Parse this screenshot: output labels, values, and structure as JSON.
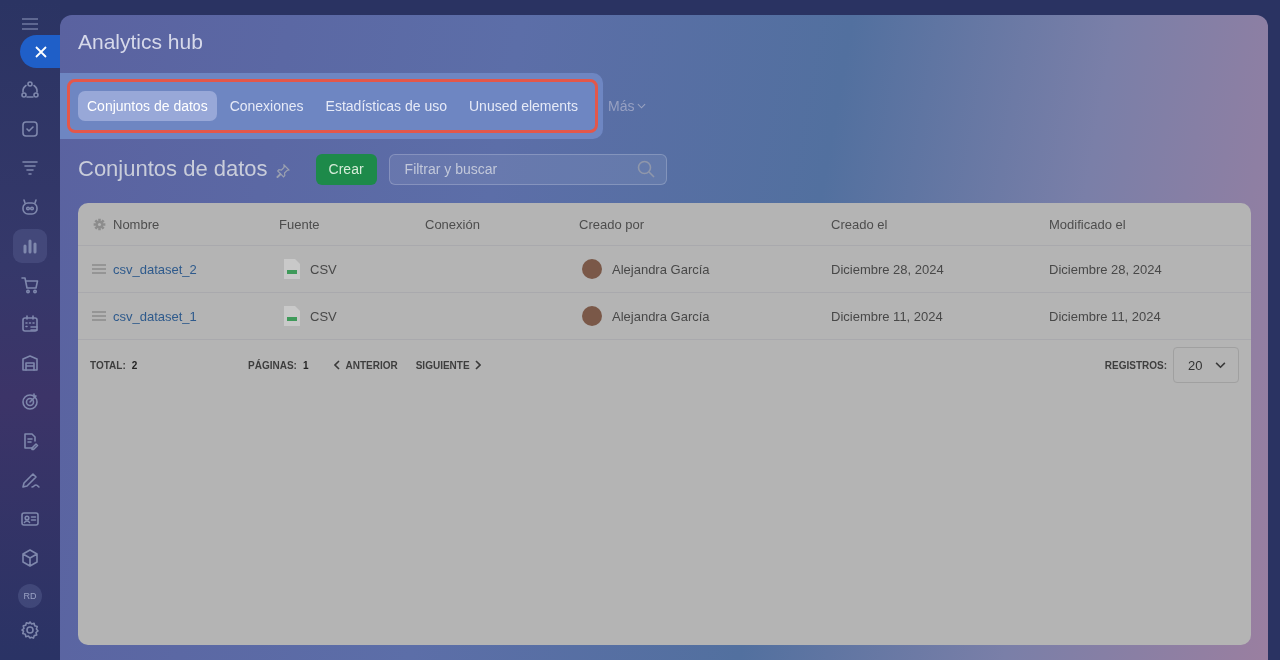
{
  "window": {
    "title": "Analytics hub"
  },
  "sidebar": {
    "items": [
      {
        "selected": false
      },
      {
        "selected": false
      },
      {
        "selected": false
      },
      {
        "selected": false
      },
      {
        "selected": true
      },
      {
        "selected": false
      },
      {
        "selected": false
      },
      {
        "selected": false
      },
      {
        "selected": false
      },
      {
        "selected": false
      },
      {
        "selected": false
      },
      {
        "selected": false
      },
      {
        "selected": false
      }
    ],
    "avatar": "RD"
  },
  "tab_bar": {
    "highlighted": true,
    "tabs": [
      {
        "label": "Conjuntos de datos",
        "selected": true
      },
      {
        "label": "Conexiones",
        "selected": false
      },
      {
        "label": "Estadísticas de uso",
        "selected": false
      },
      {
        "label": "Unused elements",
        "selected": false
      }
    ],
    "more": "Más"
  },
  "page": {
    "heading": "Conjuntos de datos",
    "create_button": "Crear",
    "search": {
      "placeholder": "Filtrar y buscar"
    }
  },
  "table": {
    "columns": [
      "Nombre",
      "Fuente",
      "Conexión",
      "Creado por",
      "Creado el",
      "Modificado el"
    ],
    "rows": [
      {
        "name": "csv_dataset_2",
        "source": "CSV",
        "created_by": "Alejandra García",
        "created_on": "Diciembre 28, 2024",
        "modified_on": "Diciembre 28, 2024"
      },
      {
        "name": "csv_dataset_1",
        "source": "CSV",
        "created_by": "Alejandra García",
        "created_on": "Diciembre 11, 2024",
        "modified_on": "Diciembre 11, 2024"
      }
    ],
    "footer": {
      "total_label": "TOTAL:",
      "total": "2",
      "pages_label": "PÁGINAS:",
      "pages": "1",
      "previous": "ANTERIOR",
      "next": "SIGUIENTE",
      "records_label": "REGISTROS:",
      "records": "20"
    }
  }
}
